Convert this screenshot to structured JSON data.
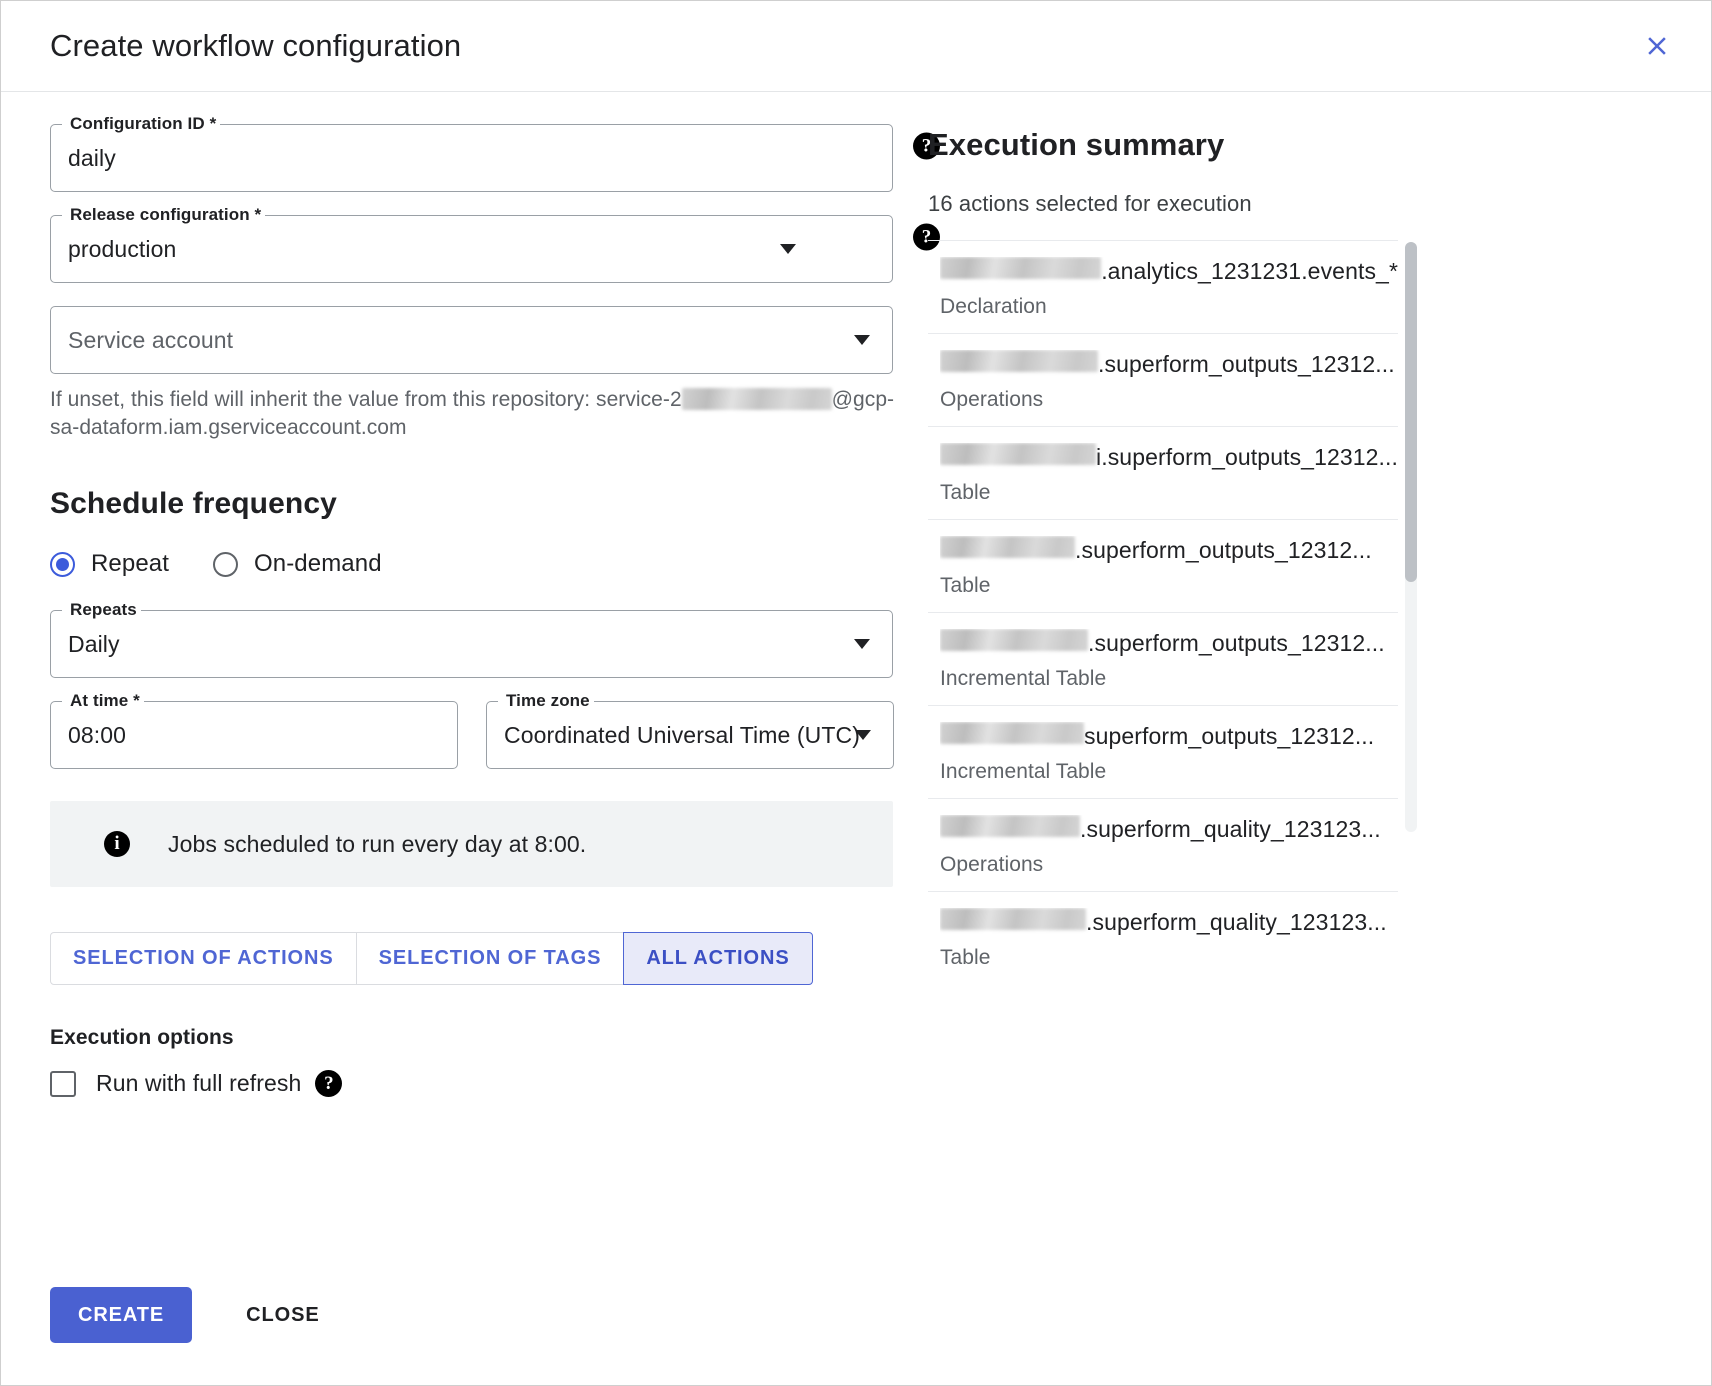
{
  "header": {
    "title": "Create workflow configuration",
    "close_icon": "close-icon"
  },
  "form": {
    "configuration_id": {
      "label": "Configuration ID *",
      "value": "daily",
      "help_icon": "help-icon"
    },
    "release_configuration": {
      "label": "Release configuration *",
      "value": "production",
      "help_icon": "help-icon",
      "caret_icon": "chevron-down-icon"
    },
    "service_account": {
      "placeholder": "Service account",
      "caret_icon": "chevron-down-icon",
      "helper_prefix": "If unset, this field will inherit the value from this repository: service-2",
      "helper_suffix": "@gcp-sa-dataform.iam.gserviceaccount.com"
    }
  },
  "schedule": {
    "section_title": "Schedule frequency",
    "options": [
      {
        "label": "Repeat",
        "selected": true
      },
      {
        "label": "On-demand",
        "selected": false
      }
    ],
    "repeats": {
      "label": "Repeats",
      "value": "Daily",
      "caret_icon": "chevron-down-icon"
    },
    "at_time": {
      "label": "At time *",
      "value": "08:00"
    },
    "time_zone": {
      "label": "Time zone",
      "value": "Coordinated Universal Time (UTC)",
      "caret_icon": "chevron-down-icon"
    },
    "info": {
      "icon": "info-icon",
      "text": "Jobs scheduled to run every day at 8:00."
    }
  },
  "tabs": [
    {
      "label": "SELECTION OF ACTIONS",
      "active": false
    },
    {
      "label": "SELECTION OF TAGS",
      "active": false
    },
    {
      "label": "ALL ACTIONS",
      "active": true
    }
  ],
  "execution_options": {
    "title": "Execution options",
    "full_refresh": {
      "label": "Run with full refresh",
      "checked": false,
      "help_icon": "help-icon"
    }
  },
  "footer": {
    "create_label": "CREATE",
    "close_label": "CLOSE"
  },
  "summary": {
    "title": "Execution summary",
    "count_text": "16 actions selected for execution",
    "actions": [
      {
        "redacted_width": 168,
        "name": ".analytics_1231231.events_*",
        "type": "Declaration"
      },
      {
        "redacted_width": 158,
        "name": ".superform_outputs_12312...",
        "type": "Operations"
      },
      {
        "redacted_width": 162,
        "name": "i.superform_outputs_12312...",
        "type": "Table"
      },
      {
        "redacted_width": 135,
        "name": ".superform_outputs_12312...",
        "type": "Table"
      },
      {
        "redacted_width": 148,
        "name": ".superform_outputs_12312...",
        "type": "Incremental Table"
      },
      {
        "redacted_width": 144,
        "name": "superform_outputs_12312...",
        "type": "Incremental Table"
      },
      {
        "redacted_width": 140,
        "name": ".superform_quality_123123...",
        "type": "Operations"
      },
      {
        "redacted_width": 146,
        "name": ".superform_quality_123123...",
        "type": "Table"
      }
    ]
  },
  "colors": {
    "accent": "#4a61d1",
    "tab_active_bg": "#e8eaf9",
    "banner_bg": "#f1f3f4"
  }
}
